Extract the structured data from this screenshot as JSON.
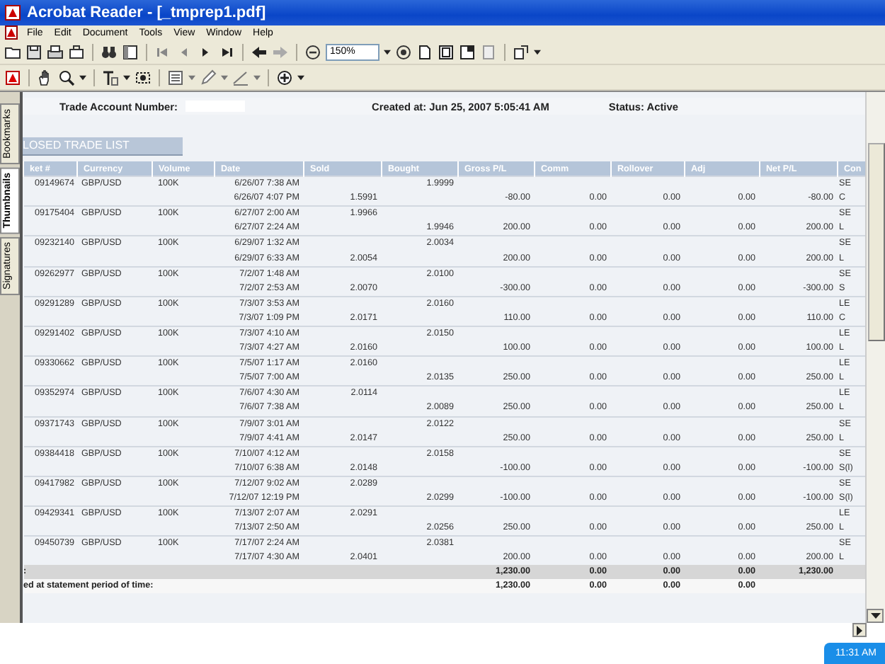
{
  "window": {
    "title": "Acrobat Reader - [_tmprep1.pdf]"
  },
  "menu": [
    "File",
    "Edit",
    "Document",
    "Tools",
    "View",
    "Window",
    "Help"
  ],
  "zoom": {
    "value": "150%"
  },
  "side_tabs": [
    {
      "label": "Bookmarks",
      "selected": false
    },
    {
      "label": "Thumbnails",
      "selected": true
    },
    {
      "label": "Signatures",
      "selected": false
    }
  ],
  "header": {
    "account_label": "Trade Account Number:",
    "created": "Created at: Jun 25, 2007 5:05:41 AM",
    "status": "Status: Active"
  },
  "section_title": "LOSED TRADE LIST",
  "columns": [
    "ket #",
    "Currency",
    "Volume",
    "Date",
    "Sold",
    "Bought",
    "Gross P/L",
    "Comm",
    "Rollover",
    "Adj",
    "Net P/L",
    "Con"
  ],
  "trades": [
    {
      "ticket": "09149674",
      "currency": "GBP/USD",
      "volume": "100K",
      "lines": [
        {
          "date": "6/26/07 7:38 AM",
          "bought": "1.9999",
          "cond": "SE"
        },
        {
          "date": "6/26/07 4:07 PM",
          "sold": "1.5991",
          "gross": "-80.00",
          "comm": "0.00",
          "rollover": "0.00",
          "adj": "0.00",
          "net": "-80.00",
          "cond": "C"
        }
      ]
    },
    {
      "ticket": "09175404",
      "currency": "GBP/USD",
      "volume": "100K",
      "lines": [
        {
          "date": "6/27/07 2:00 AM",
          "sold": "1.9966",
          "cond": "SE"
        },
        {
          "date": "6/27/07 2:24 AM",
          "bought": "1.9946",
          "gross": "200.00",
          "comm": "0.00",
          "rollover": "0.00",
          "adj": "0.00",
          "net": "200.00",
          "cond": "L"
        }
      ]
    },
    {
      "ticket": "09232140",
      "currency": "GBP/USD",
      "volume": "100K",
      "lines": [
        {
          "date": "6/29/07 1:32 AM",
          "bought": "2.0034",
          "cond": "SE"
        },
        {
          "date": "6/29/07 6:33 AM",
          "sold": "2.0054",
          "gross": "200.00",
          "comm": "0.00",
          "rollover": "0.00",
          "adj": "0.00",
          "net": "200.00",
          "cond": "L"
        }
      ]
    },
    {
      "ticket": "09262977",
      "currency": "GBP/USD",
      "volume": "100K",
      "lines": [
        {
          "date": "7/2/07 1:48 AM",
          "bought": "2.0100",
          "cond": "SE"
        },
        {
          "date": "7/2/07 2:53 AM",
          "sold": "2.0070",
          "gross": "-300.00",
          "comm": "0.00",
          "rollover": "0.00",
          "adj": "0.00",
          "net": "-300.00",
          "cond": "S"
        }
      ]
    },
    {
      "ticket": "09291289",
      "currency": "GBP/USD",
      "volume": "100K",
      "lines": [
        {
          "date": "7/3/07 3:53 AM",
          "bought": "2.0160",
          "cond": "LE"
        },
        {
          "date": "7/3/07 1:09 PM",
          "sold": "2.0171",
          "gross": "110.00",
          "comm": "0.00",
          "rollover": "0.00",
          "adj": "0.00",
          "net": "110.00",
          "cond": "C"
        }
      ]
    },
    {
      "ticket": "09291402",
      "currency": "GBP/USD",
      "volume": "100K",
      "lines": [
        {
          "date": "7/3/07 4:10 AM",
          "bought": "2.0150",
          "cond": "LE"
        },
        {
          "date": "7/3/07 4:27 AM",
          "sold": "2.0160",
          "gross": "100.00",
          "comm": "0.00",
          "rollover": "0.00",
          "adj": "0.00",
          "net": "100.00",
          "cond": "L"
        }
      ]
    },
    {
      "ticket": "09330662",
      "currency": "GBP/USD",
      "volume": "100K",
      "lines": [
        {
          "date": "7/5/07 1:17 AM",
          "sold": "2.0160",
          "cond": "LE"
        },
        {
          "date": "7/5/07 7:00 AM",
          "bought": "2.0135",
          "gross": "250.00",
          "comm": "0.00",
          "rollover": "0.00",
          "adj": "0.00",
          "net": "250.00",
          "cond": "L"
        }
      ]
    },
    {
      "ticket": "09352974",
      "currency": "GBP/USD",
      "volume": "100K",
      "lines": [
        {
          "date": "7/6/07 4:30 AM",
          "sold": "2.0114",
          "cond": "LE"
        },
        {
          "date": "7/6/07 7:38 AM",
          "bought": "2.0089",
          "gross": "250.00",
          "comm": "0.00",
          "rollover": "0.00",
          "adj": "0.00",
          "net": "250.00",
          "cond": "L"
        }
      ]
    },
    {
      "ticket": "09371743",
      "currency": "GBP/USD",
      "volume": "100K",
      "lines": [
        {
          "date": "7/9/07 3:01 AM",
          "bought": "2.0122",
          "cond": "SE"
        },
        {
          "date": "7/9/07 4:41 AM",
          "sold": "2.0147",
          "gross": "250.00",
          "comm": "0.00",
          "rollover": "0.00",
          "adj": "0.00",
          "net": "250.00",
          "cond": "L"
        }
      ]
    },
    {
      "ticket": "09384418",
      "currency": "GBP/USD",
      "volume": "100K",
      "lines": [
        {
          "date": "7/10/07 4:12 AM",
          "bought": "2.0158",
          "cond": "SE"
        },
        {
          "date": "7/10/07 6:38 AM",
          "sold": "2.0148",
          "gross": "-100.00",
          "comm": "0.00",
          "rollover": "0.00",
          "adj": "0.00",
          "net": "-100.00",
          "cond": "S(l)"
        }
      ]
    },
    {
      "ticket": "09417982",
      "currency": "GBP/USD",
      "volume": "100K",
      "lines": [
        {
          "date": "7/12/07 9:02 AM",
          "sold": "2.0289",
          "cond": "SE"
        },
        {
          "date": "7/12/07 12:19 PM",
          "bought": "2.0299",
          "gross": "-100.00",
          "comm": "0.00",
          "rollover": "0.00",
          "adj": "0.00",
          "net": "-100.00",
          "cond": "S(l)"
        }
      ]
    },
    {
      "ticket": "09429341",
      "currency": "GBP/USD",
      "volume": "100K",
      "lines": [
        {
          "date": "7/13/07 2:07 AM",
          "sold": "2.0291",
          "cond": "LE"
        },
        {
          "date": "7/13/07 2:50 AM",
          "bought": "2.0256",
          "gross": "250.00",
          "comm": "0.00",
          "rollover": "0.00",
          "adj": "0.00",
          "net": "250.00",
          "cond": "L"
        }
      ]
    },
    {
      "ticket": "09450739",
      "currency": "GBP/USD",
      "volume": "100K",
      "lines": [
        {
          "date": "7/17/07 2:24 AM",
          "bought": "2.0381",
          "cond": "SE"
        },
        {
          "date": "7/17/07 4:30 AM",
          "sold": "2.0401",
          "gross": "200.00",
          "comm": "0.00",
          "rollover": "0.00",
          "adj": "0.00",
          "net": "200.00",
          "cond": "L"
        }
      ]
    }
  ],
  "totals": [
    {
      "label": ":",
      "gross": "1,230.00",
      "comm": "0.00",
      "rollover": "0.00",
      "adj": "0.00",
      "net": "1,230.00",
      "shaded": true
    },
    {
      "label": "ed at statement period of time:",
      "gross": "1,230.00",
      "comm": "0.00",
      "rollover": "0.00",
      "adj": "0.00",
      "shaded": false
    }
  ],
  "clock": "11:31 AM"
}
